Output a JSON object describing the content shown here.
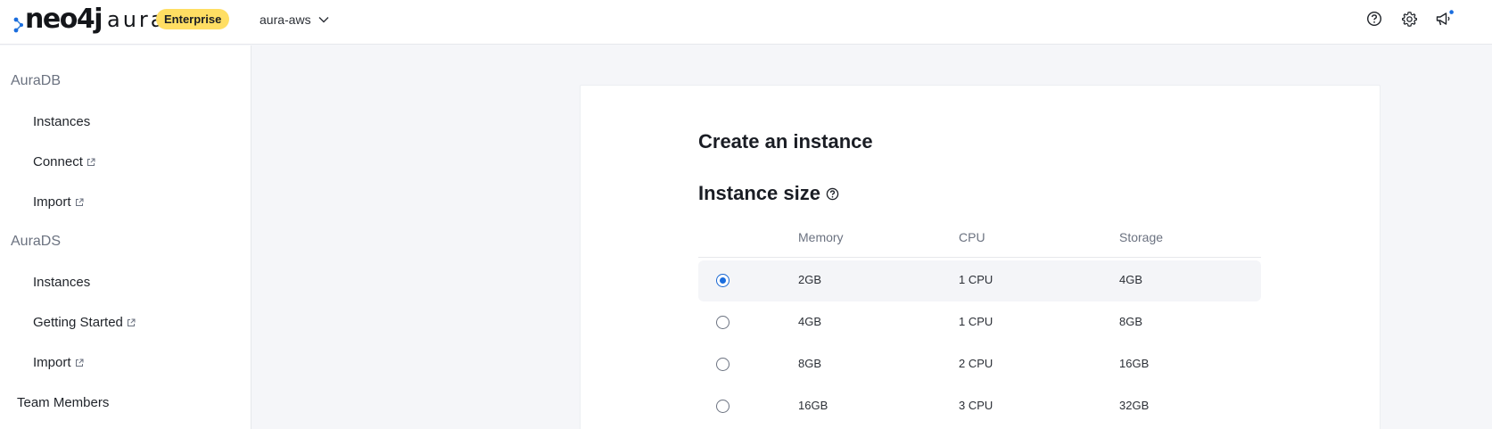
{
  "header": {
    "logo_neo": "neo4j",
    "logo_aura": "aura",
    "badge": "Enterprise",
    "project": "aura-aws",
    "icons": [
      "help-icon",
      "gear-icon",
      "megaphone-icon"
    ],
    "accent_color": "#ffde63",
    "notification_dot_color": "#1a6dde"
  },
  "sidebar": {
    "groups": [
      {
        "label": "AuraDB",
        "items": [
          {
            "label": "Instances",
            "external": false
          },
          {
            "label": "Connect",
            "external": true
          },
          {
            "label": "Import",
            "external": true
          }
        ]
      },
      {
        "label": "AuraDS",
        "items": [
          {
            "label": "Instances",
            "external": false
          },
          {
            "label": "Getting Started",
            "external": true
          },
          {
            "label": "Import",
            "external": true
          }
        ]
      }
    ],
    "team_members": "Team Members"
  },
  "main": {
    "title": "Create an instance",
    "section_title": "Instance size",
    "columns": [
      "Memory",
      "CPU",
      "Storage"
    ],
    "rows": [
      {
        "memory": "2GB",
        "cpu": "1 CPU",
        "storage": "4GB",
        "selected": true
      },
      {
        "memory": "4GB",
        "cpu": "1 CPU",
        "storage": "8GB",
        "selected": false
      },
      {
        "memory": "8GB",
        "cpu": "2 CPU",
        "storage": "16GB",
        "selected": false
      },
      {
        "memory": "16GB",
        "cpu": "3 CPU",
        "storage": "32GB",
        "selected": false
      }
    ],
    "selected_color": "#1a6dde"
  }
}
